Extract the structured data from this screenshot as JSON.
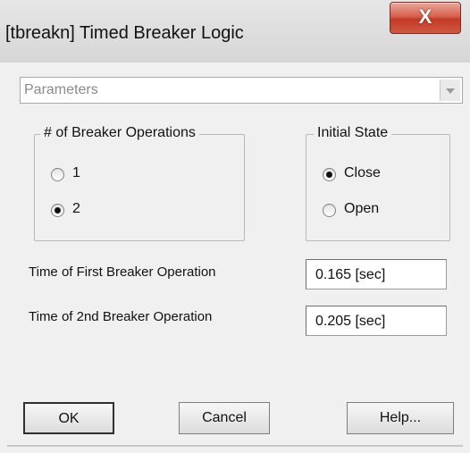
{
  "window": {
    "title": "[tbreakn] Timed Breaker Logic",
    "close_glyph": "X"
  },
  "combo": {
    "value": "Parameters"
  },
  "operations_group": {
    "label": "# of Breaker Operations",
    "options": [
      {
        "label": "1",
        "selected": false
      },
      {
        "label": "2",
        "selected": true
      }
    ]
  },
  "state_group": {
    "label": "Initial State",
    "options": [
      {
        "label": "Close",
        "selected": true
      },
      {
        "label": "Open",
        "selected": false
      }
    ]
  },
  "fields": {
    "first_label": "Time of First Breaker Operation",
    "first_value": "0.165 [sec]",
    "second_label": "Time of 2nd Breaker Operation",
    "second_value": "0.205 [sec]"
  },
  "buttons": {
    "ok": "OK",
    "cancel": "Cancel",
    "help": "Help..."
  },
  "colors": {
    "close_button": "#c23a25",
    "dialog_background": "#f0f0f0"
  }
}
